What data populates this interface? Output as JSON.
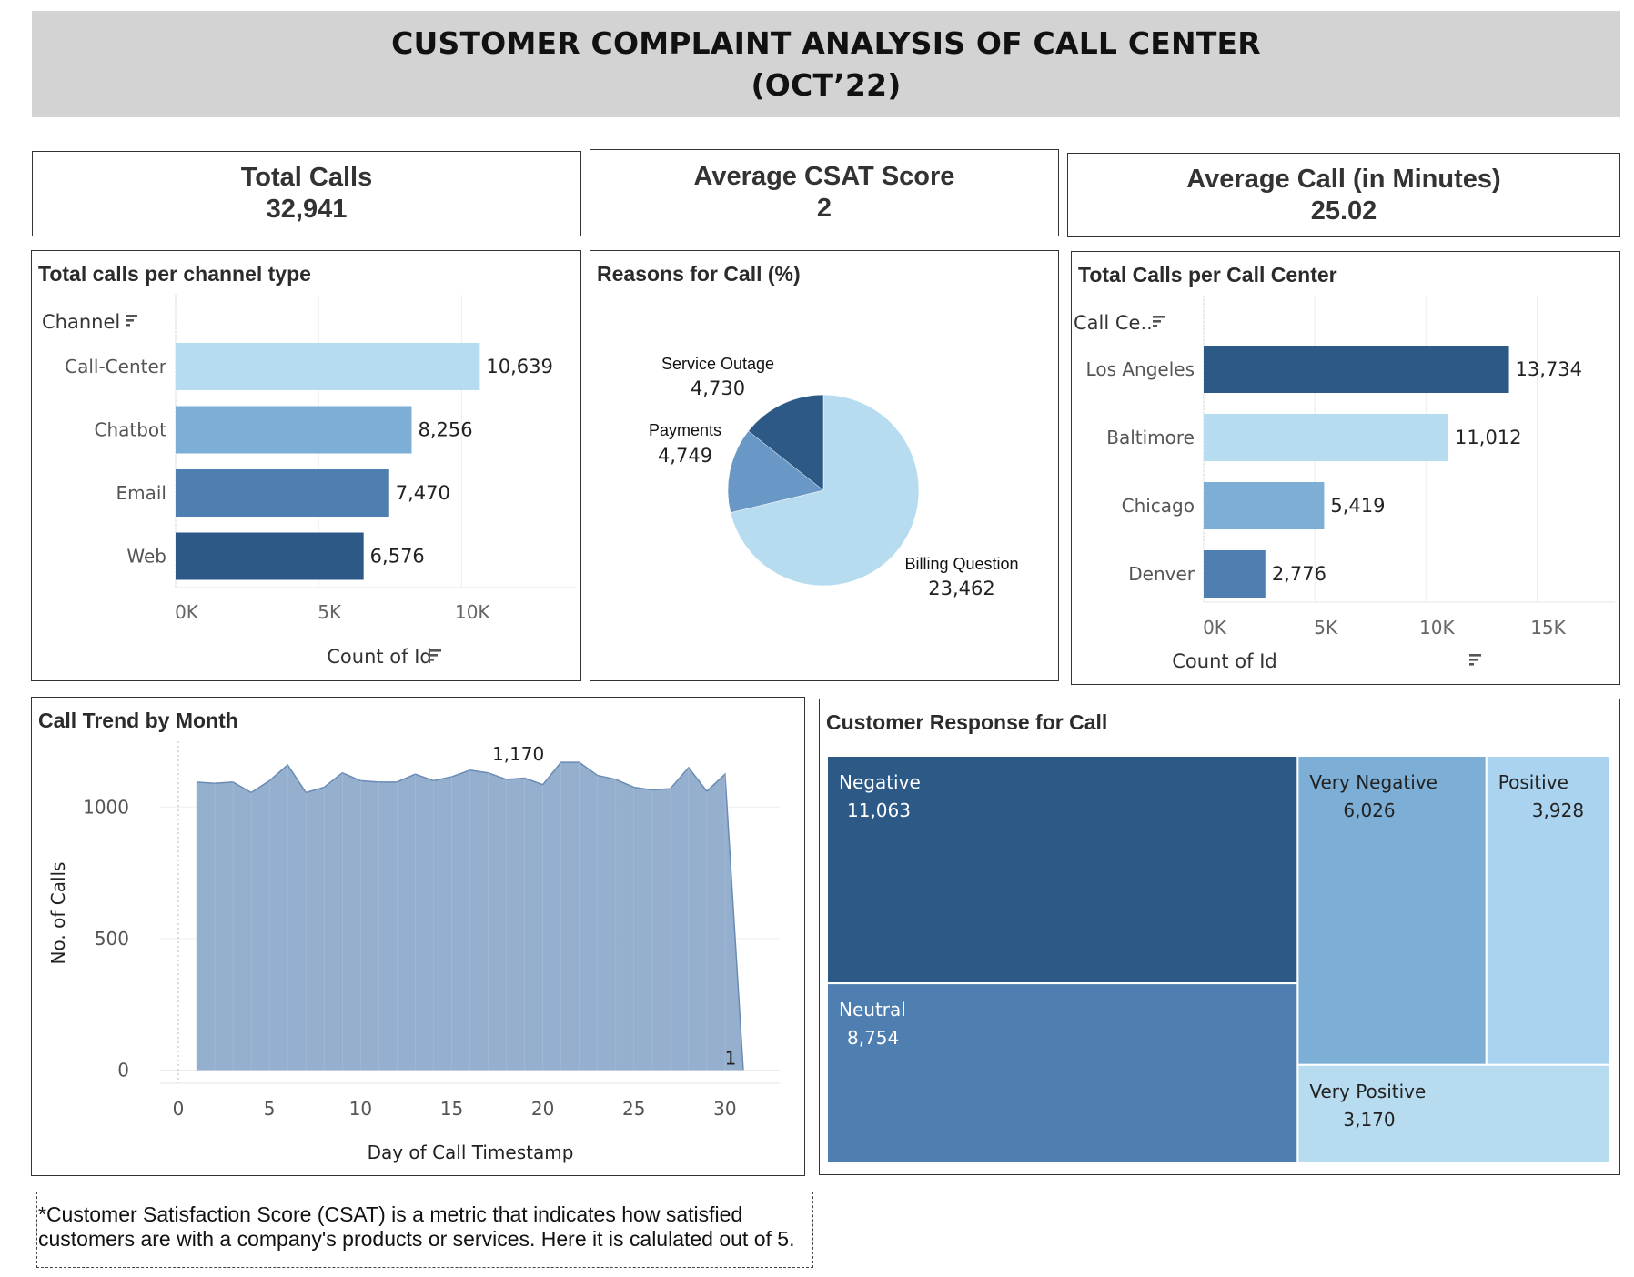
{
  "header": {
    "title_line1": "CUSTOMER COMPLAINT ANALYSIS OF CALL CENTER",
    "title_line2": "(OCT’22)"
  },
  "kpis": [
    {
      "label": "Total Calls",
      "value": "32,941"
    },
    {
      "label": "Average CSAT Score",
      "value": "2"
    },
    {
      "label": "Average Call (in Minutes)",
      "value": "25.02"
    }
  ],
  "footnote": {
    "line1": "*Customer Satisfaction Score (CSAT) is a metric that indicates how satisfied",
    "line2": "customers are with a company's products or services. Here it is calulated out of 5."
  },
  "colors": {
    "lightest": "#b7dcf0",
    "light": "#7daed5",
    "mid": "#4f7fb0",
    "dark": "#2c5986",
    "area": "#8fabcb",
    "area_line": "#6a8bb5",
    "banner": "#d3d3d3"
  },
  "chart_data": [
    {
      "type": "bar",
      "orientation": "horizontal",
      "title": "Total calls per channel type",
      "category_header": "Channel",
      "categories": [
        "Call-Center",
        "Chatbot",
        "Email",
        "Web"
      ],
      "values": [
        10639,
        8256,
        7470,
        6576
      ],
      "value_labels": [
        "10,639",
        "8,256",
        "7,470",
        "6,576"
      ],
      "colors": [
        "#b7dcf0",
        "#7daed5",
        "#4f7fb0",
        "#2c5986"
      ],
      "xlabel": "Count of Id",
      "xticks": [
        {
          "v": 0,
          "label": "0K"
        },
        {
          "v": 5000,
          "label": "5K"
        },
        {
          "v": 10000,
          "label": "10K"
        }
      ],
      "xlim": [
        0,
        14000
      ]
    },
    {
      "type": "pie",
      "title": "Reasons for Call (%)",
      "slices": [
        {
          "label": "Billing Question",
          "value": 23462,
          "value_label": "23,462",
          "color": "#b7dcf0"
        },
        {
          "label": "Payments",
          "value": 4749,
          "value_label": "4,749",
          "color": "#6a98c6"
        },
        {
          "label": "Service Outage",
          "value": 4730,
          "value_label": "4,730",
          "color": "#2c5986"
        }
      ]
    },
    {
      "type": "bar",
      "orientation": "horizontal",
      "title": "Total Calls per Call Center",
      "category_header": "Call Ce..",
      "categories": [
        "Los Angeles",
        "Baltimore",
        "Chicago",
        "Denver"
      ],
      "values": [
        13734,
        11012,
        5419,
        2776
      ],
      "value_labels": [
        "13,734",
        "11,012",
        "5,419",
        "2,776"
      ],
      "colors": [
        "#2c5986",
        "#b7dcf0",
        "#7daed5",
        "#4f7fb0"
      ],
      "xlabel": "Count of Id",
      "xticks": [
        {
          "v": 0,
          "label": "0K"
        },
        {
          "v": 5000,
          "label": "5K"
        },
        {
          "v": 10000,
          "label": "10K"
        },
        {
          "v": 15000,
          "label": "15K"
        }
      ],
      "xlim": [
        0,
        18500
      ]
    },
    {
      "type": "area",
      "title": "Call Trend by Month",
      "xlabel": "Day of Call Timestamp",
      "ylabel": "No. of Calls",
      "x": [
        1,
        2,
        3,
        4,
        5,
        6,
        7,
        8,
        9,
        10,
        11,
        12,
        13,
        14,
        15,
        16,
        17,
        18,
        19,
        20,
        21,
        22,
        23,
        24,
        25,
        26,
        27,
        28,
        29,
        30,
        31
      ],
      "y": [
        1095,
        1090,
        1095,
        1055,
        1100,
        1160,
        1055,
        1075,
        1130,
        1100,
        1095,
        1095,
        1125,
        1100,
        1115,
        1140,
        1130,
        1105,
        1110,
        1085,
        1170,
        1170,
        1120,
        1105,
        1075,
        1065,
        1070,
        1150,
        1060,
        1125,
        1
      ],
      "annotations": [
        {
          "x": 21,
          "y": 1170,
          "label": "1,170"
        },
        {
          "x": 31,
          "y": 1,
          "label": "1"
        }
      ],
      "xticks": [
        0,
        5,
        10,
        15,
        20,
        25,
        30
      ],
      "yticks": [
        0,
        500,
        1000
      ],
      "xlim": [
        -1,
        33
      ],
      "ylim": [
        -50,
        1250
      ]
    },
    {
      "type": "treemap",
      "title": "Customer Response for Call",
      "items": [
        {
          "label": "Negative",
          "value": 11063,
          "value_label": "11,063",
          "color": "#2c5986",
          "text_color": "#ffffff"
        },
        {
          "label": "Neutral",
          "value": 8754,
          "value_label": "8,754",
          "color": "#4f7fb0",
          "text_color": "#ffffff"
        },
        {
          "label": "Very Negative",
          "value": 6026,
          "value_label": "6,026",
          "color": "#7daed5",
          "text_color": "#222222"
        },
        {
          "label": "Positive",
          "value": 3928,
          "value_label": "3,928",
          "color": "#a9d3ee",
          "text_color": "#222222"
        },
        {
          "label": "Very Positive",
          "value": 3170,
          "value_label": "3,170",
          "color": "#b7dcf0",
          "text_color": "#222222"
        }
      ]
    }
  ]
}
